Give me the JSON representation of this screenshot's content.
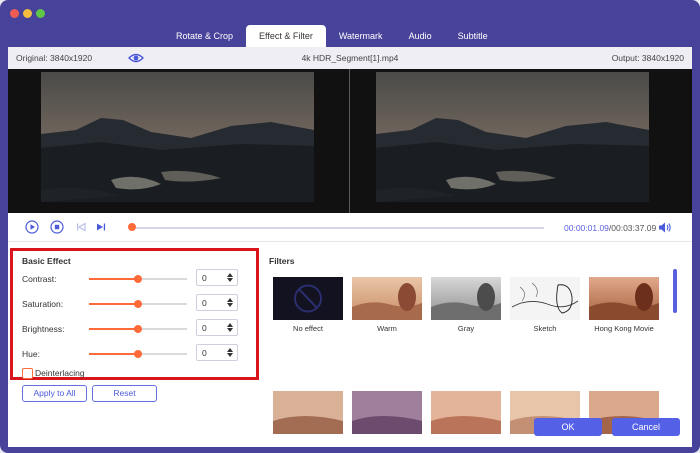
{
  "tabs": [
    {
      "label": "Rotate & Crop",
      "active": false
    },
    {
      "label": "Effect & Filter",
      "active": true
    },
    {
      "label": "Watermark",
      "active": false
    },
    {
      "label": "Audio",
      "active": false
    },
    {
      "label": "Subtitle",
      "active": false
    }
  ],
  "infobar": {
    "original": "Original: 3840x1920",
    "filename": "4k HDR_Segment[1].mp4",
    "output": "Output: 3840x1920"
  },
  "player": {
    "current_time": "00:00:01.09",
    "total_time": "/00:03:37.09",
    "progress_fraction": 0.0
  },
  "basic_effect": {
    "title": "Basic Effect",
    "controls": [
      {
        "label": "Contrast:",
        "value": "0",
        "level": 0.5
      },
      {
        "label": "Saturation:",
        "value": "0",
        "level": 0.5
      },
      {
        "label": "Brightness:",
        "value": "0",
        "level": 0.5
      },
      {
        "label": "Hue:",
        "value": "0",
        "level": 0.5
      }
    ],
    "deinterlacing_label": "Deinterlacing",
    "deinterlacing_checked": false
  },
  "buttons": {
    "apply_all": "Apply to All",
    "reset": "Reset",
    "ok": "OK",
    "cancel": "Cancel"
  },
  "filters": {
    "title": "Filters",
    "row1": [
      "No effect",
      "Warm",
      "Gray",
      "Sketch",
      "Hong Kong Movie"
    ]
  },
  "colors": {
    "accent": "#5460e6",
    "slider": "#ff6a3a",
    "highlight_box": "#d8141d",
    "window": "#48439a"
  }
}
